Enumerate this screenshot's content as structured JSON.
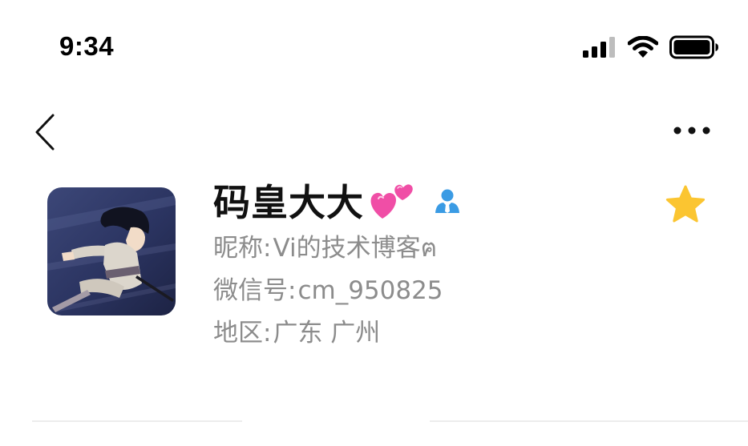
{
  "status_bar": {
    "time": "9:34"
  },
  "nav": {
    "back_icon": "chevron-left-icon",
    "more_icon": "ellipsis-icon"
  },
  "profile": {
    "name": "码皇大大",
    "name_emoji": "two-hearts-icon",
    "contact_badge_icon": "contact-person-icon",
    "nickname_label": "昵称:",
    "nickname_value": "Vi的技术博客ฅ",
    "wechat_id_label": "微信号:",
    "wechat_id_value": "cm_950825",
    "region_label": "地区:",
    "region_value": "广东 广州",
    "star_icon": "star-icon"
  },
  "colors": {
    "star": "#fbc531",
    "badge": "#3a9be4",
    "hearts": "#f04ea6",
    "secondary_text": "#8c8c8c"
  }
}
